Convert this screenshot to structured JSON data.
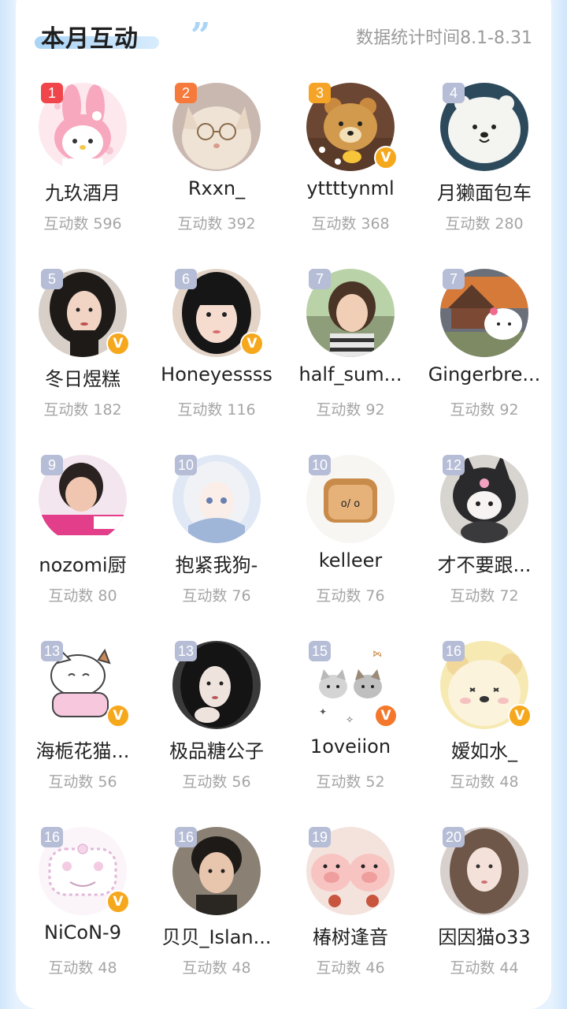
{
  "header": {
    "title": "本月互动",
    "stat_time": "数据统计时间8.1-8.31"
  },
  "count_prefix": "互动数",
  "colors": {
    "rank1": "#f0464b",
    "rank2": "#f57a3c",
    "rank3": "#f6a428",
    "rank_other": "#b6bdd6",
    "vip_badge": "#f6a81c",
    "vip_badge_alt": "#f4782c",
    "title_underline": "#a8d4f6"
  },
  "users": [
    {
      "rank": "1",
      "name": "九玖酒月",
      "count": "互动数 596",
      "avatar": "pink-bunny-avatar",
      "vip": false
    },
    {
      "rank": "2",
      "name": "Rxxn_",
      "count": "互动数 392",
      "avatar": "cat-with-glasses-avatar",
      "vip": false
    },
    {
      "rank": "3",
      "name": "yttttynml",
      "count": "互动数 368",
      "avatar": "bear-plush-avatar",
      "vip": true
    },
    {
      "rank": "4",
      "name": "月獭面包车",
      "count": "互动数 280",
      "avatar": "white-bear-avatar",
      "vip": false
    },
    {
      "rank": "5",
      "name": "冬日煜糕",
      "count": "互动数 182",
      "avatar": "woman-portrait-avatar",
      "vip": true
    },
    {
      "rank": "6",
      "name": "Honeyessss",
      "count": "互动数 116",
      "avatar": "girl-bangs-avatar",
      "vip": true
    },
    {
      "rank": "7",
      "name": "half_sum...",
      "count": "互动数 92",
      "avatar": "person-outdoor-avatar",
      "vip": false
    },
    {
      "rank": "7",
      "name": "Gingerbre...",
      "count": "互动数 92",
      "avatar": "kitty-fire-avatar",
      "vip": false
    },
    {
      "rank": "9",
      "name": "nozomi厨",
      "count": "互动数 80",
      "avatar": "tv-person-avatar",
      "vip": false
    },
    {
      "rank": "10",
      "name": "抱紧我狗-",
      "count": "互动数 76",
      "avatar": "anime-girl-avatar",
      "vip": false
    },
    {
      "rank": "10",
      "name": "kelleer",
      "count": "互动数 76",
      "avatar": "toast-avatar",
      "vip": false
    },
    {
      "rank": "12",
      "name": "才不要跟...",
      "count": "互动数 72",
      "avatar": "kuromi-plush-avatar",
      "vip": false
    },
    {
      "rank": "13",
      "name": "海栀花猫...",
      "count": "互动数 56",
      "avatar": "sketch-cat-avatar",
      "vip": true
    },
    {
      "rank": "13",
      "name": "极品糖公子",
      "count": "互动数 56",
      "avatar": "dark-hair-girl-avatar",
      "vip": false
    },
    {
      "rank": "15",
      "name": "1oveiion",
      "count": "互动数 52",
      "avatar": "two-cats-avatar",
      "vip": true,
      "vip_alt": true
    },
    {
      "rank": "16",
      "name": "嫒如水_",
      "count": "互动数 48",
      "avatar": "cream-bear-avatar",
      "vip": true
    },
    {
      "rank": "16",
      "name": "NiCoN-9",
      "count": "互动数 48",
      "avatar": "doodle-frame-avatar",
      "vip": true
    },
    {
      "rank": "16",
      "name": "贝贝_Islan...",
      "count": "互动数 48",
      "avatar": "boy-portrait-avatar",
      "vip": false
    },
    {
      "rank": "19",
      "name": "椿树逢音",
      "count": "互动数 46",
      "avatar": "pigs-avatar",
      "vip": false
    },
    {
      "rank": "20",
      "name": "因因猫o33",
      "count": "互动数 44",
      "avatar": "long-hair-girl-avatar",
      "vip": false
    }
  ]
}
